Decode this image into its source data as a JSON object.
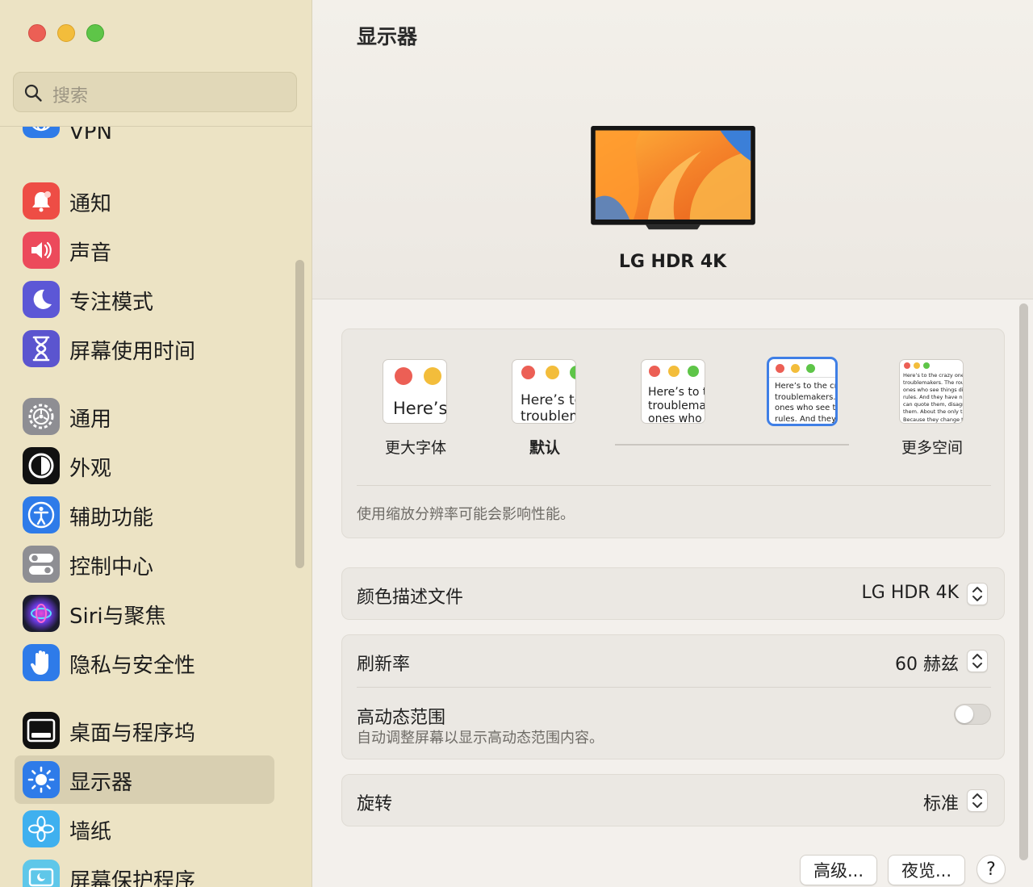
{
  "window": {
    "title": "显示器"
  },
  "sidebar": {
    "search_placeholder": "搜索",
    "items": [
      {
        "label": "VPN",
        "icon": "vpn-globe-icon"
      },
      {
        "label": "通知",
        "icon": "bell-icon"
      },
      {
        "label": "声音",
        "icon": "speaker-icon"
      },
      {
        "label": "专注模式",
        "icon": "moon-icon"
      },
      {
        "label": "屏幕使用时间",
        "icon": "hourglass-icon"
      },
      {
        "label": "通用",
        "icon": "gear-icon"
      },
      {
        "label": "外观",
        "icon": "appearance-icon"
      },
      {
        "label": "辅助功能",
        "icon": "accessibility-icon"
      },
      {
        "label": "控制中心",
        "icon": "toggles-icon"
      },
      {
        "label": "Siri与聚焦",
        "icon": "siri-icon"
      },
      {
        "label": "隐私与安全性",
        "icon": "hand-icon"
      },
      {
        "label": "桌面与程序坞",
        "icon": "dock-icon"
      },
      {
        "label": "显示器",
        "icon": "brightness-icon",
        "selected": true
      },
      {
        "label": "墙纸",
        "icon": "flower-icon"
      },
      {
        "label": "屏幕保护程序",
        "icon": "screensaver-icon"
      }
    ]
  },
  "main": {
    "title": "显示器",
    "display_name": "LG HDR 4K",
    "resolution": {
      "options": [
        {
          "label": "更大字体",
          "preview": "Here’s"
        },
        {
          "label": "默认",
          "preview": "Here’s to\ntroublem"
        },
        {
          "label": "",
          "preview": "Here’s to t\ntroublema\nones who"
        },
        {
          "label": "",
          "preview": "Here’s to the cr\ntroublemakers.\nones who see t\nrules. And they",
          "selected": true
        },
        {
          "label": "更多空间",
          "preview": "Here’s to the crazy one\ntroublemakers. The rou\nones who see things dif\nrules. And they have no\ncan quote them, disagre\nthem. About the only th\nBecause they change th"
        }
      ],
      "note": "使用缩放分辨率可能会影响性能。"
    },
    "color_profile": {
      "label": "颜色描述文件",
      "value": "LG HDR 4K"
    },
    "refresh_rate": {
      "label": "刷新率",
      "value": "60 赫兹"
    },
    "hdr": {
      "label": "高动态范围",
      "description": "自动调整屏幕以显示高动态范围内容。",
      "enabled": false
    },
    "rotation": {
      "label": "旋转",
      "value": "标准"
    },
    "buttons": {
      "advanced": "高级...",
      "night_shift": "夜览...",
      "help": "?"
    }
  },
  "colors": {
    "accent": "#3f7fe6",
    "sidebar_bg": "#ece3c4",
    "selected_bg": "#d8cfb1"
  }
}
